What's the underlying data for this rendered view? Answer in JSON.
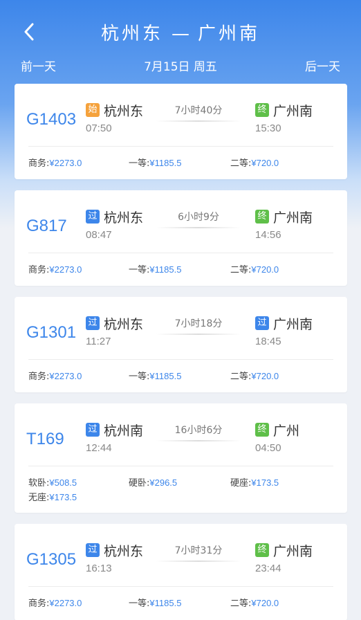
{
  "header": {
    "from": "杭州东",
    "arrow": "—",
    "to": "广州南",
    "prev_day": "前一天",
    "date": "7月15日 周五",
    "next_day": "后一天"
  },
  "trains": [
    {
      "number": "G1403",
      "dep_badge": "始",
      "dep_station": "杭州东",
      "dep_time": "07:50",
      "duration": "7小时40分",
      "arr_badge": "终",
      "arr_station": "广州南",
      "arr_time": "15:30",
      "prices": [
        {
          "label": "商务:",
          "value": "¥2273.0"
        },
        {
          "label": "一等:",
          "value": "¥1185.5"
        },
        {
          "label": "二等:",
          "value": "¥720.0"
        }
      ]
    },
    {
      "number": "G817",
      "dep_badge": "过",
      "dep_station": "杭州东",
      "dep_time": "08:47",
      "duration": "6小时9分",
      "arr_badge": "终",
      "arr_station": "广州南",
      "arr_time": "14:56",
      "prices": [
        {
          "label": "商务:",
          "value": "¥2273.0"
        },
        {
          "label": "一等:",
          "value": "¥1185.5"
        },
        {
          "label": "二等:",
          "value": "¥720.0"
        }
      ]
    },
    {
      "number": "G1301",
      "dep_badge": "过",
      "dep_station": "杭州东",
      "dep_time": "11:27",
      "duration": "7小时18分",
      "arr_badge": "过",
      "arr_station": "广州南",
      "arr_time": "18:45",
      "prices": [
        {
          "label": "商务:",
          "value": "¥2273.0"
        },
        {
          "label": "一等:",
          "value": "¥1185.5"
        },
        {
          "label": "二等:",
          "value": "¥720.0"
        }
      ]
    },
    {
      "number": "T169",
      "dep_badge": "过",
      "dep_station": "杭州南",
      "dep_time": "12:44",
      "duration": "16小时6分",
      "arr_badge": "终",
      "arr_station": "广州",
      "arr_time": "04:50",
      "prices": [
        {
          "label": "软卧:",
          "value": "¥508.5"
        },
        {
          "label": "硬卧:",
          "value": "¥296.5"
        },
        {
          "label": "硬座:",
          "value": "¥173.5"
        },
        {
          "label": "无座:",
          "value": "¥173.5"
        }
      ]
    },
    {
      "number": "G1305",
      "dep_badge": "过",
      "dep_station": "杭州东",
      "dep_time": "16:13",
      "duration": "7小时31分",
      "arr_badge": "终",
      "arr_station": "广州南",
      "arr_time": "23:44",
      "prices": [
        {
          "label": "商务:",
          "value": "¥2273.0"
        },
        {
          "label": "一等:",
          "value": "¥1185.5"
        },
        {
          "label": "二等:",
          "value": "¥720.0"
        }
      ]
    }
  ],
  "colors": {
    "accent": "#3d86ea",
    "badge_start": "#f5a23c",
    "badge_pass": "#3d86ea",
    "badge_end": "#5fbf49"
  },
  "icons": {
    "back": "chevron-left-icon"
  }
}
